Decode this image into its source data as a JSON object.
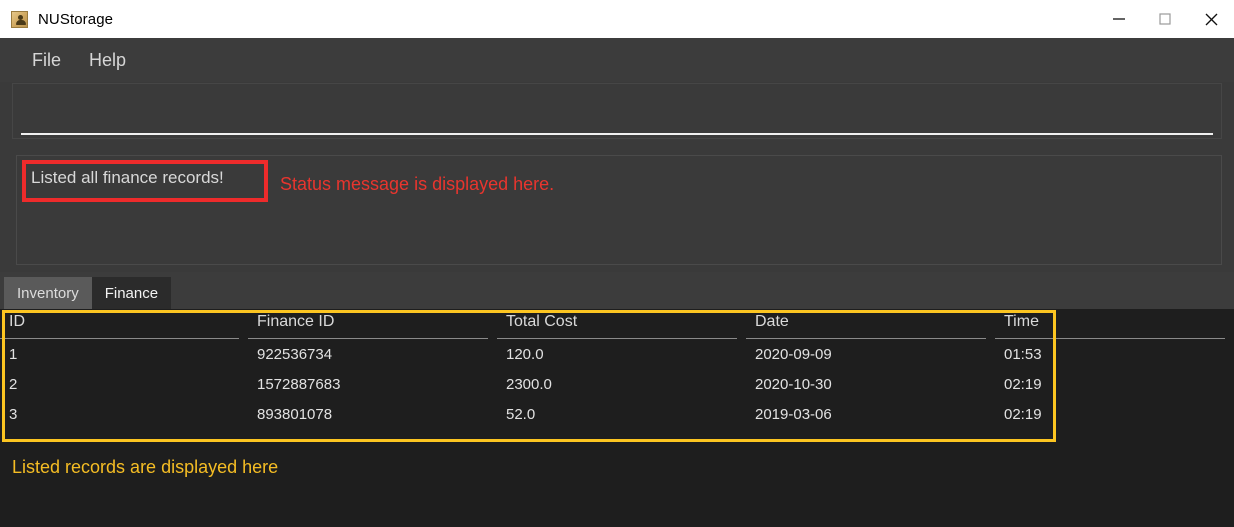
{
  "window": {
    "title": "NUStorage",
    "icon": "java-duke-icon",
    "controls": {
      "minimize": "minimize-icon",
      "maximize": "maximize-icon",
      "close": "close-icon"
    }
  },
  "menubar": {
    "items": [
      {
        "label": "File"
      },
      {
        "label": "Help"
      }
    ]
  },
  "command_input": {
    "value": "",
    "placeholder": ""
  },
  "status": {
    "message": "Listed all finance records!"
  },
  "tabs": [
    {
      "label": "Inventory",
      "active": false
    },
    {
      "label": "Finance",
      "active": true
    }
  ],
  "table": {
    "columns": [
      "ID",
      "Finance ID",
      "Total Cost",
      "Date",
      "Time"
    ],
    "rows": [
      {
        "id": "1",
        "finance_id": "922536734",
        "total_cost": "120.0",
        "date": "2020-09-09",
        "time": "01:53"
      },
      {
        "id": "2",
        "finance_id": "1572887683",
        "total_cost": "2300.0",
        "date": "2020-10-30",
        "time": "02:19"
      },
      {
        "id": "3",
        "finance_id": "893801078",
        "total_cost": "52.0",
        "date": "2019-03-06",
        "time": "02:19"
      }
    ]
  },
  "annotations": [
    {
      "text": "Status message is displayed here.",
      "color": "#e8352e"
    },
    {
      "text": "Listed records are displayed here",
      "color": "#f5bd24"
    }
  ],
  "colors": {
    "titlebar_bg": "#ffffff",
    "window_bg": "#3a3a3a",
    "menubar_bg": "#3c3c3c",
    "table_bg": "#1e1e1e",
    "annotation_red": "#ee2b2b",
    "annotation_yellow": "#fcc521",
    "tab_active_bg": "#2b2b2b",
    "tab_inactive_bg": "#5a5a5a"
  }
}
